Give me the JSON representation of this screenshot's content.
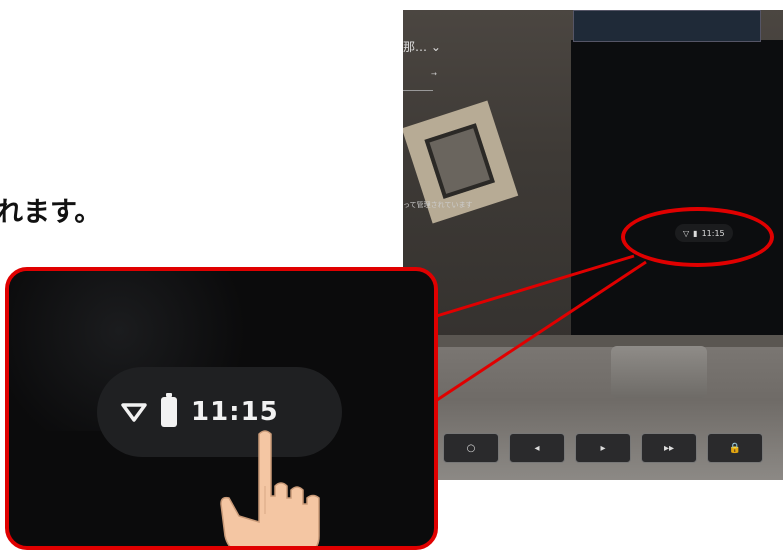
{
  "instruction": {
    "text_fragment": "れます。"
  },
  "screen": {
    "user_name_partial": "那…",
    "managed_text_partial": "って管理されています",
    "status_time": "11:15"
  },
  "zoom": {
    "status_time": "11:15"
  },
  "keys": [
    "○",
    "◂",
    "▸",
    "▸▸",
    "🔒"
  ],
  "colors": {
    "highlight": "#e00000",
    "finger_skin": "#f4c6a3"
  },
  "icons": [
    "wifi-icon",
    "battery-icon",
    "pointing-hand-icon"
  ]
}
